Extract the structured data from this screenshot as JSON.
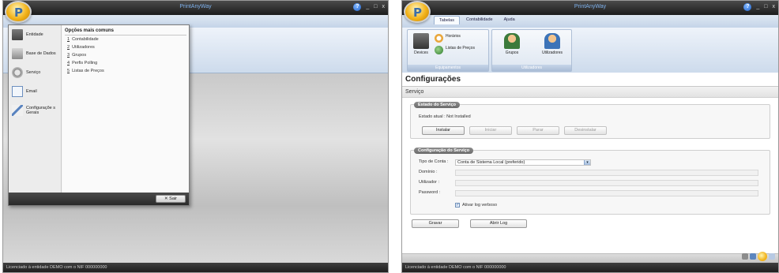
{
  "app_title": "PrintAnyWay",
  "window_controls": {
    "help": "?",
    "minimize": "_",
    "maximize": "□",
    "close": "x"
  },
  "status_text": "Licenciado à entidade DEMO com o NIF 000000000",
  "app_menu": {
    "left_items": [
      {
        "label": "Entidade",
        "icon": "entidade-icon"
      },
      {
        "label": "Base de Dados",
        "icon": "database-icon"
      },
      {
        "label": "Serviço",
        "icon": "service-icon"
      },
      {
        "label": "Email",
        "icon": "email-icon"
      },
      {
        "label": "Configuraçõe s Gerais",
        "icon": "settings-icon"
      }
    ],
    "recent_title": "Opções mais comuns",
    "recent_items": [
      {
        "key": "1",
        "label": "Contabilidade"
      },
      {
        "key": "2",
        "label": "Utilizadores"
      },
      {
        "key": "3",
        "label": "Grupos"
      },
      {
        "key": "4",
        "label": "Perfis Polling"
      },
      {
        "key": "5",
        "label": "Listas de Preços"
      }
    ],
    "exit_label": "Sair"
  },
  "ribbon": {
    "tabs": [
      "Tabelas",
      "Contabilidade",
      "Ajuda"
    ],
    "active_tab": 0,
    "groups": [
      {
        "label": "Equipamentos",
        "buttons": [
          "Devices",
          "Horários",
          "Listas de Preços"
        ]
      },
      {
        "label": "Utilizadores",
        "buttons": [
          "Grupos",
          "Utilizadores"
        ]
      }
    ]
  },
  "page": {
    "title": "Configurações",
    "section": "Serviço",
    "service_state": {
      "panel_title": "Estado do Serviço",
      "status_label": "Estado atual :",
      "status_value": "Not Installed",
      "buttons": [
        {
          "label": "Instalar",
          "enabled": true
        },
        {
          "label": "Iniciar",
          "enabled": false
        },
        {
          "label": "Parar",
          "enabled": false
        },
        {
          "label": "Desinstalar",
          "enabled": false
        }
      ]
    },
    "service_config": {
      "panel_title": "Configuração do Serviço",
      "account_type_label": "Tipo de Conta :",
      "account_type_value": "Conta de Sistema Local (preferido)",
      "domain_label": "Domínio :",
      "user_label": "Utilizador :",
      "password_label": "Password :",
      "verbose_label": "Ativar log verboso",
      "verbose_checked": true
    },
    "save_label": "Gravar",
    "open_log_label": "Abrir Log"
  }
}
